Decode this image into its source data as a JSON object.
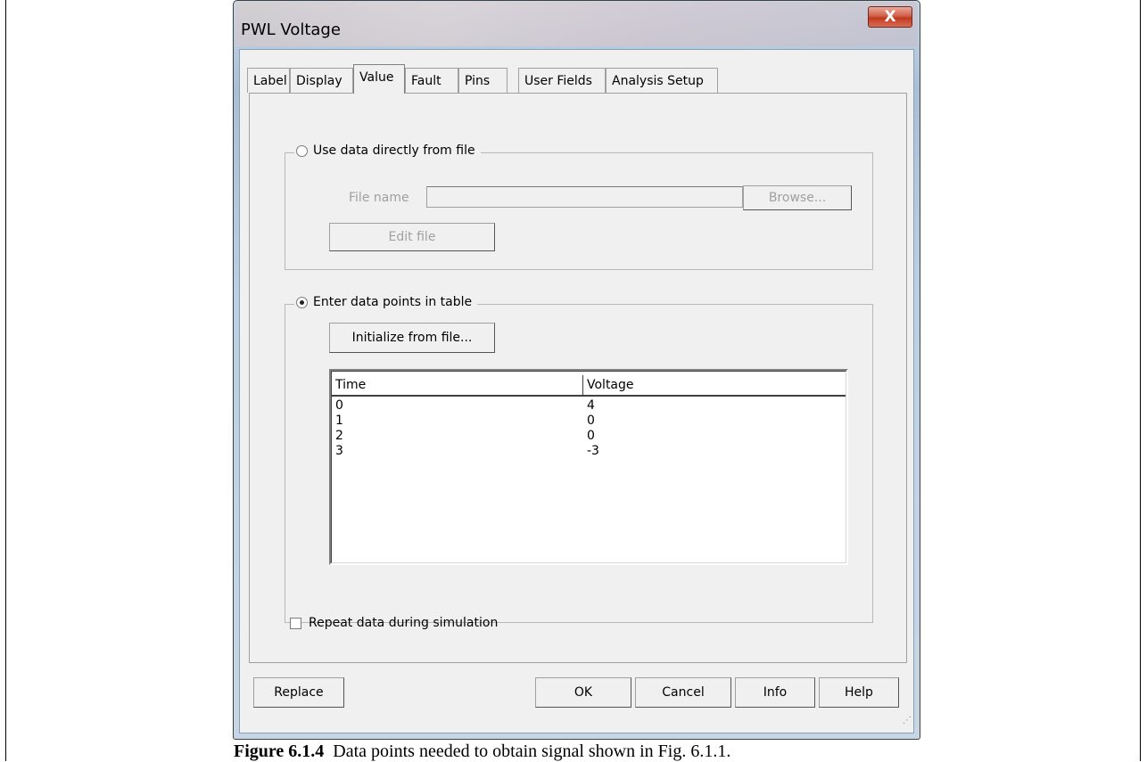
{
  "window": {
    "title": "PWL Voltage",
    "close_glyph": "X"
  },
  "tabs": [
    {
      "label": "Label"
    },
    {
      "label": "Display"
    },
    {
      "label": "Value",
      "active": true
    },
    {
      "label": "Fault"
    },
    {
      "label": "Pins"
    },
    {
      "label": "User Fields"
    },
    {
      "label": "Analysis Setup"
    }
  ],
  "file_group": {
    "radio_label": "Use data directly from file",
    "selected": false,
    "file_name_label": "File name",
    "file_name_value": "",
    "browse_label": "Browse...",
    "edit_file_label": "Edit file"
  },
  "table_group": {
    "radio_label": "Enter data points in table",
    "selected": true,
    "initialize_label": "Initialize from file...",
    "columns": [
      "Time",
      "Voltage"
    ],
    "rows": [
      [
        "0",
        "4"
      ],
      [
        "1",
        "0"
      ],
      [
        "2",
        "0"
      ],
      [
        "3",
        "-3"
      ]
    ]
  },
  "repeat_checkbox": {
    "label": "Repeat data during simulation",
    "checked": false
  },
  "buttons": {
    "replace": "Replace",
    "ok": "OK",
    "cancel": "Cancel",
    "info": "Info",
    "help": "Help"
  },
  "caption": {
    "figure_label": "Figure 6.1.4",
    "text": "Data points needed to obtain signal shown in Fig. 6.1.1."
  }
}
